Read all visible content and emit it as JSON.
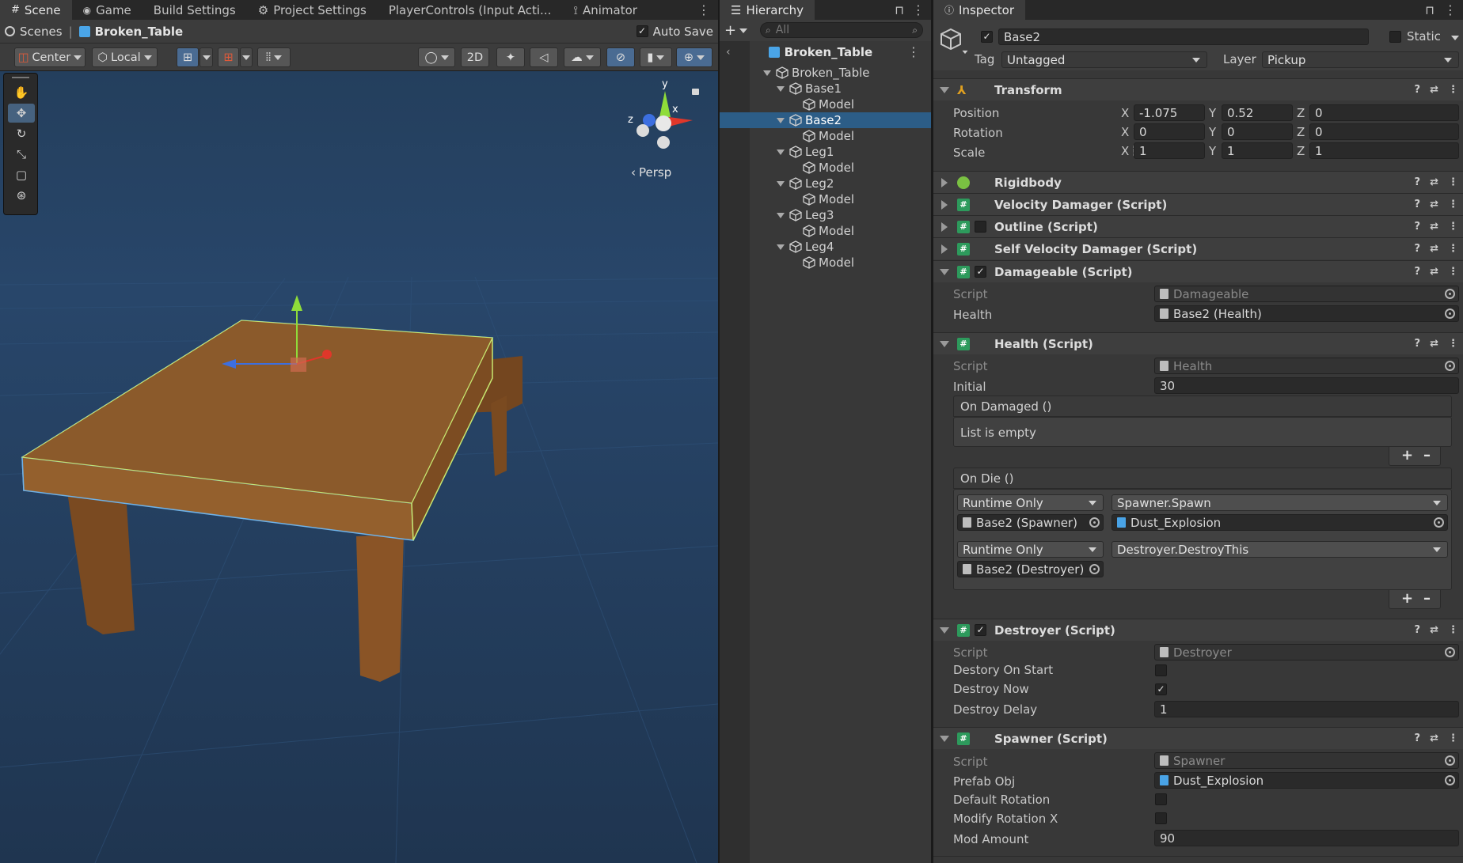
{
  "scene_panel": {
    "tabs": [
      {
        "label": "Scene"
      },
      {
        "label": "Game"
      },
      {
        "label": "Build Settings"
      },
      {
        "label": "Project Settings"
      },
      {
        "label": "PlayerControls (Input Acti..."
      },
      {
        "label": "Animator"
      }
    ],
    "breadcrumb": {
      "root": "Scenes",
      "current": "Broken_Table"
    },
    "auto_save_label": "Auto Save",
    "auto_save_checked": true,
    "toolbar": {
      "pivot": "Center",
      "space": "Local",
      "mode_2d": "2D"
    },
    "gizmo": {
      "y": "y",
      "x": "x",
      "z": "z",
      "projection": "Persp"
    }
  },
  "hierarchy": {
    "tab": "Hierarchy",
    "search_placeholder": "All",
    "scene_root": "Broken_Table",
    "items": [
      {
        "label": "Broken_Table",
        "depth": 0,
        "expanded": true,
        "selected": false
      },
      {
        "label": "Base1",
        "depth": 1,
        "expanded": true,
        "selected": false
      },
      {
        "label": "Model",
        "depth": 2,
        "expanded": false,
        "selected": false
      },
      {
        "label": "Base2",
        "depth": 1,
        "expanded": true,
        "selected": true
      },
      {
        "label": "Model",
        "depth": 2,
        "expanded": false,
        "selected": false
      },
      {
        "label": "Leg1",
        "depth": 1,
        "expanded": true,
        "selected": false
      },
      {
        "label": "Model",
        "depth": 2,
        "expanded": false,
        "selected": false
      },
      {
        "label": "Leg2",
        "depth": 1,
        "expanded": true,
        "selected": false
      },
      {
        "label": "Model",
        "depth": 2,
        "expanded": false,
        "selected": false
      },
      {
        "label": "Leg3",
        "depth": 1,
        "expanded": true,
        "selected": false
      },
      {
        "label": "Model",
        "depth": 2,
        "expanded": false,
        "selected": false
      },
      {
        "label": "Leg4",
        "depth": 1,
        "expanded": true,
        "selected": false
      },
      {
        "label": "Model",
        "depth": 2,
        "expanded": false,
        "selected": false
      }
    ]
  },
  "inspector": {
    "tab": "Inspector",
    "object_name": "Base2",
    "active": true,
    "static_label": "Static",
    "tag_label": "Tag",
    "tag_value": "Untagged",
    "layer_label": "Layer",
    "layer_value": "Pickup",
    "transform": {
      "title": "Transform",
      "position_label": "Position",
      "rotation_label": "Rotation",
      "scale_label": "Scale",
      "position": {
        "x": "-1.075",
        "y": "0.52",
        "z": "0"
      },
      "rotation": {
        "x": "0",
        "y": "0",
        "z": "0"
      },
      "scale": {
        "x": "1",
        "y": "1",
        "z": "1"
      }
    },
    "collapsed_components": [
      {
        "title": "Rigidbody"
      },
      {
        "title": "Velocity Damager (Script)"
      },
      {
        "title": "Outline (Script)"
      },
      {
        "title": "Self Velocity Damager (Script)"
      }
    ],
    "damageable": {
      "title": "Damageable (Script)",
      "script_label": "Script",
      "script_value": "Damageable",
      "health_label": "Health",
      "health_value": "Base2 (Health)"
    },
    "health": {
      "title": "Health (Script)",
      "script_label": "Script",
      "script_value": "Health",
      "initial_label": "Initial",
      "initial_value": "30",
      "on_damaged": {
        "title": "On Damaged ()",
        "empty_text": "List is empty"
      },
      "on_die": {
        "title": "On Die ()",
        "entries": [
          {
            "mode": "Runtime Only",
            "function": "Spawner.Spawn",
            "target": "Base2 (Spawner)",
            "argument": "Dust_Explosion"
          },
          {
            "mode": "Runtime Only",
            "function": "Destroyer.DestroyThis",
            "target": "Base2 (Destroyer)"
          }
        ]
      }
    },
    "destroyer": {
      "title": "Destroyer (Script)",
      "script_label": "Script",
      "script_value": "Destroyer",
      "destroy_on_start_label": "Destory On Start",
      "destroy_on_start": false,
      "destroy_now_label": "Destroy Now",
      "destroy_now": true,
      "destroy_delay_label": "Destroy Delay",
      "destroy_delay": "1"
    },
    "spawner": {
      "title": "Spawner (Script)",
      "script_label": "Script",
      "script_value": "Spawner",
      "prefab_label": "Prefab Obj",
      "prefab_value": "Dust_Explosion",
      "default_rotation_label": "Default Rotation",
      "default_rotation": false,
      "modify_rotation_x_label": "Modify Rotation X",
      "modify_rotation_x": false,
      "mod_amount_label": "Mod Amount",
      "mod_amount": "90"
    }
  }
}
